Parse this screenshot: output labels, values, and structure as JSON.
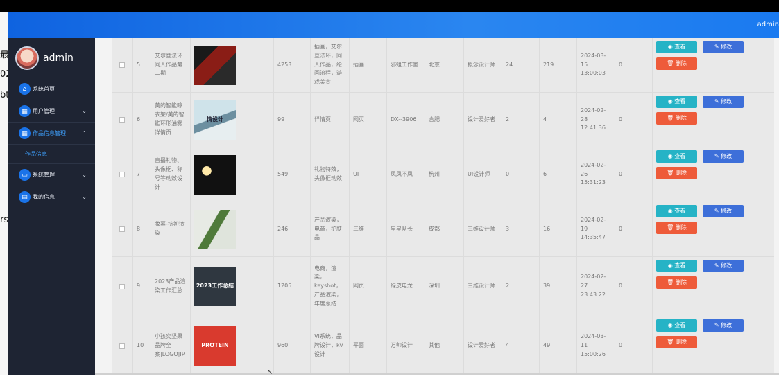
{
  "background_fragments": [
    "最近",
    "02",
    "bt",
    "rs"
  ],
  "header": {
    "user": "admin"
  },
  "sidebar": {
    "username": "admin",
    "items": [
      {
        "label": "系统首页",
        "icon": "home-icon"
      },
      {
        "label": "用户管理",
        "icon": "grid-icon"
      },
      {
        "label": "作品信息管理",
        "icon": "grid-icon"
      },
      {
        "label": "系统管理",
        "icon": "monitor-icon"
      },
      {
        "label": "我的信息",
        "icon": "card-icon"
      }
    ],
    "sub_item": "作品信息"
  },
  "actions": {
    "view": "查看",
    "edit": "修改",
    "delete": "删除"
  },
  "rows": [
    {
      "index": "5",
      "title": "艾尔登法环同人作品第二期",
      "views": "4253",
      "tags": "插画，艾尔登法环，同人作品，绘画流程，游戏美宣",
      "category": "插画",
      "author": "邪蛆工作室",
      "city": "北京",
      "role": "概念设计师",
      "likes": "24",
      "favs": "219",
      "date": "2024-03-15 13:00:03",
      "status": "0"
    },
    {
      "index": "6",
      "title": "美的智能晾衣架/美的智能环形油雾详情页",
      "views": "99",
      "tags": "详情页",
      "category": "网页",
      "author": "DX--3906",
      "city": "合肥",
      "role": "设计爱好者",
      "likes": "2",
      "favs": "4",
      "date": "2024-02-28 12:41:36",
      "status": "0"
    },
    {
      "index": "7",
      "title": "直播礼物、头像框、称号等动效设计",
      "views": "549",
      "tags": "礼物特效，头像框动效",
      "category": "UI",
      "author": "凤凤不凤",
      "city": "杭州",
      "role": "UI设计师",
      "likes": "0",
      "favs": "6",
      "date": "2024-02-26 15:31:23",
      "status": "0"
    },
    {
      "index": "8",
      "title": "妆幂-抗初渲染",
      "views": "246",
      "tags": "产品渲染，电商，护肤品",
      "category": "三维",
      "author": "星星队长",
      "city": "成都",
      "role": "三维设计师",
      "likes": "3",
      "favs": "16",
      "date": "2024-02-19 14:35:47",
      "status": "0"
    },
    {
      "index": "9",
      "title": "2023产品渲染工作汇总",
      "views": "1205",
      "tags": "电商，渲染，keyshot，产品渲染，年度总结",
      "category": "网页",
      "author": "绿皮电龙",
      "city": "深圳",
      "role": "三维设计师",
      "likes": "2",
      "favs": "39",
      "date": "2024-02-27 23:43:22",
      "status": "0"
    },
    {
      "index": "10",
      "title": "小孩奕坚果品牌全案|LOGO|IP",
      "views": "960",
      "tags": "VI系统，品牌设计，kv设计",
      "category": "平面",
      "author": "万帅设计",
      "city": "其他",
      "role": "设计爱好者",
      "likes": "4",
      "favs": "49",
      "date": "2024-03-11 15:00:26",
      "status": "0"
    }
  ],
  "thumb_text": {
    "r6": "情设计",
    "r9": "2023工作总结",
    "r10": "PROTEIN"
  },
  "colors": {
    "header": "#1a7af0",
    "sidebar": "#1e2433",
    "view": "#26b3c6",
    "edit": "#3d6fd9",
    "delete": "#ee5b3a"
  }
}
